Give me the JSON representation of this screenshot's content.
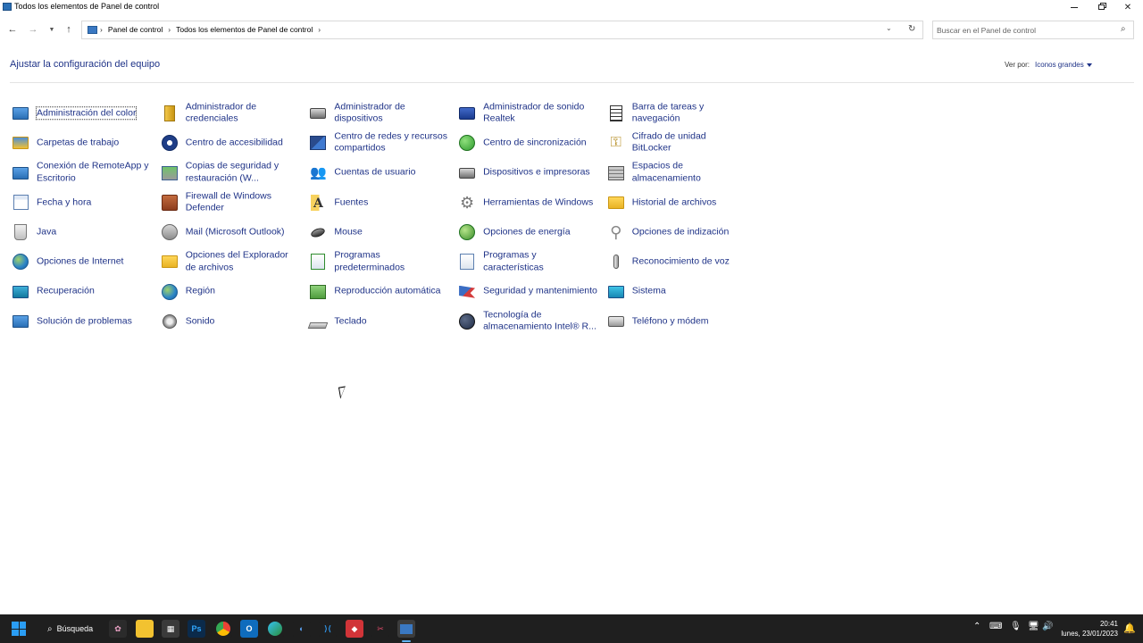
{
  "window": {
    "title": "Todos los elementos de Panel de control"
  },
  "navbar": {
    "breadcrumbs": [
      "Panel de control",
      "Todos los elementos de Panel de control"
    ],
    "search_placeholder": "Buscar en el Panel de control"
  },
  "header": {
    "title": "Ajustar la configuración del equipo",
    "view_by_label": "Ver por:",
    "view_by_value": "Iconos grandes"
  },
  "items": [
    {
      "label": "Administración del color",
      "icon": "color-management-icon"
    },
    {
      "label": "Administrador de credenciales",
      "icon": "credential-manager-icon"
    },
    {
      "label": "Administrador de dispositivos",
      "icon": "device-manager-icon"
    },
    {
      "label": "Administrador de sonido Realtek",
      "icon": "realtek-audio-icon"
    },
    {
      "label": "Barra de tareas y navegación",
      "icon": "taskbar-icon"
    },
    {
      "label": "Carpetas de trabajo",
      "icon": "work-folders-icon"
    },
    {
      "label": "Centro de accesibilidad",
      "icon": "accessibility-icon"
    },
    {
      "label": "Centro de redes y recursos compartidos",
      "icon": "network-center-icon"
    },
    {
      "label": "Centro de sincronización",
      "icon": "sync-center-icon"
    },
    {
      "label": "Cifrado de unidad BitLocker",
      "icon": "bitlocker-icon"
    },
    {
      "label": "Conexión de RemoteApp y Escritorio",
      "icon": "remoteapp-icon"
    },
    {
      "label": "Copias de seguridad y restauración (W...",
      "icon": "backup-restore-icon"
    },
    {
      "label": "Cuentas de usuario",
      "icon": "user-accounts-icon"
    },
    {
      "label": "Dispositivos e impresoras",
      "icon": "devices-printers-icon"
    },
    {
      "label": "Espacios de almacenamiento",
      "icon": "storage-spaces-icon"
    },
    {
      "label": "Fecha y hora",
      "icon": "date-time-icon"
    },
    {
      "label": "Firewall de Windows Defender",
      "icon": "firewall-icon"
    },
    {
      "label": "Fuentes",
      "icon": "fonts-icon"
    },
    {
      "label": "Herramientas de Windows",
      "icon": "windows-tools-icon"
    },
    {
      "label": "Historial de archivos",
      "icon": "file-history-icon"
    },
    {
      "label": "Java",
      "icon": "java-icon"
    },
    {
      "label": "Mail (Microsoft Outlook)",
      "icon": "mail-icon"
    },
    {
      "label": "Mouse",
      "icon": "mouse-icon"
    },
    {
      "label": "Opciones de energía",
      "icon": "power-options-icon"
    },
    {
      "label": "Opciones de indización",
      "icon": "indexing-options-icon"
    },
    {
      "label": "Opciones de Internet",
      "icon": "internet-options-icon"
    },
    {
      "label": "Opciones del Explorador de archivos",
      "icon": "explorer-options-icon"
    },
    {
      "label": "Programas predeterminados",
      "icon": "default-programs-icon"
    },
    {
      "label": "Programas y características",
      "icon": "programs-features-icon"
    },
    {
      "label": "Reconocimiento de voz",
      "icon": "speech-recognition-icon"
    },
    {
      "label": "Recuperación",
      "icon": "recovery-icon"
    },
    {
      "label": "Región",
      "icon": "region-icon"
    },
    {
      "label": "Reproducción automática",
      "icon": "autoplay-icon"
    },
    {
      "label": "Seguridad y mantenimiento",
      "icon": "security-maintenance-icon"
    },
    {
      "label": "Sistema",
      "icon": "system-icon"
    },
    {
      "label": "Solución de problemas",
      "icon": "troubleshooting-icon"
    },
    {
      "label": "Sonido",
      "icon": "sound-icon"
    },
    {
      "label": "Teclado",
      "icon": "keyboard-icon"
    },
    {
      "label": "Tecnología de almacenamiento Intel® R...",
      "icon": "intel-storage-icon"
    },
    {
      "label": "Teléfono y módem",
      "icon": "phone-modem-icon"
    }
  ],
  "taskbar": {
    "search_label": "Búsqueda",
    "time": "20:41",
    "date": "lunes, 23/01/2023"
  }
}
